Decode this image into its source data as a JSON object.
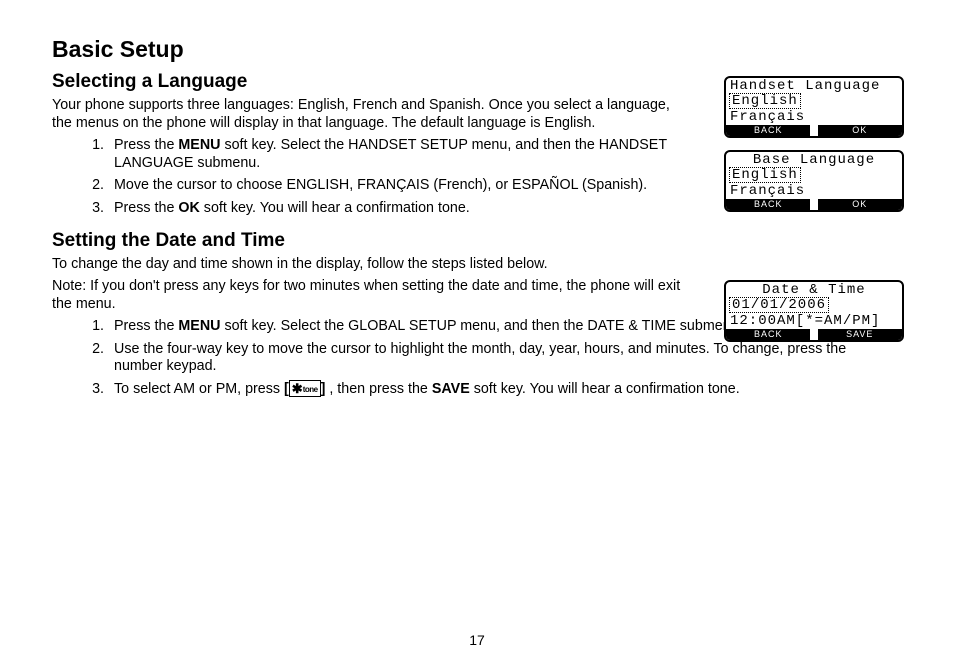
{
  "title": "Basic Setup",
  "page_number": "17",
  "section1": {
    "heading": "Selecting a Language",
    "intro": "Your phone supports three languages: English, French and Spanish. Once you select a language, the menus on the phone will display in that language. The default language is English.",
    "steps": {
      "s1_a": "Press the ",
      "s1_b": "MENU",
      "s1_c": " soft key. Select the HANDSET SETUP menu, and then the HANDSET LANGUAGE submenu.",
      "s2": "Move the cursor to choose ENGLISH, FRANÇAIS (French), or ESPAÑOL (Span­ish).",
      "s3_a": "Press the ",
      "s3_b": "OK",
      "s3_c": " soft key. You will hear a confirmation tone."
    }
  },
  "section2": {
    "heading": "Setting the Date and Time",
    "intro1": "To change the day and time shown in the display, follow the steps listed below.",
    "intro2": "Note: If you don't press any keys for two minutes when setting the date and time, the phone will exit the menu.",
    "steps": {
      "s1_a": "Press the ",
      "s1_b": "MENU",
      "s1_c": " soft key. Select the GLOBAL SETUP menu, and then the DATE & TIME submenu.",
      "s2": "Use the four-way key to move the cursor to highlight the month, day, year, hours, and minutes. To change, press the number keypad.",
      "s3_a": "To select AM or PM, press ",
      "s3_b": " , then press the ",
      "s3_c": "SAVE",
      "s3_d": " soft key. You will hear a confirmation tone."
    }
  },
  "key_icon": {
    "open": "[",
    "star": "✱",
    "tone": "tone",
    "close": "]"
  },
  "lcd1": {
    "title": "Handset Language",
    "line1": "English",
    "line2": "Français",
    "left": "BACK",
    "right": "OK"
  },
  "lcd2": {
    "title": "Base Language",
    "line1": "English",
    "line2": "Français",
    "left": "BACK",
    "right": "OK"
  },
  "lcd3": {
    "title": "Date & Time",
    "line1": "01/01/2006",
    "line2": "12:00AM[*=AM/PM]",
    "left": "BACK",
    "right": "SAVE"
  }
}
